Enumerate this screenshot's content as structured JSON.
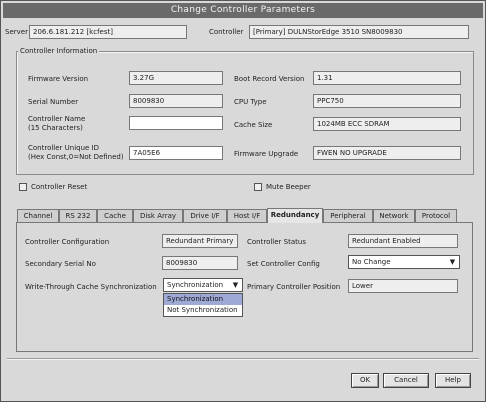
{
  "window": {
    "title": "Change Controller Parameters"
  },
  "top": {
    "server_label": "Server",
    "server_value": "206.6.181.212 [kcfest]",
    "controller_label": "Controller",
    "controller_value": "[Primary] DULNStorEdge 3510 SN8009830"
  },
  "controller_info": {
    "legend": "Controller Information",
    "firmware_label": "Firmware Version",
    "firmware_value": "3.27G",
    "bootrecord_label": "Boot Record Version",
    "bootrecord_value": "1.31",
    "serial_label": "Serial Number",
    "serial_value": "8009830",
    "cpu_label": "CPU Type",
    "cpu_value": "PPC750",
    "name_label_1": "Controller Name",
    "name_label_2": "(15 Characters)",
    "name_value": "",
    "cache_label": "Cache Size",
    "cache_value": "1024MB ECC SDRAM",
    "unique_label_1": "Controller Unique ID",
    "unique_label_2": "(Hex Const,0=Not Defined)",
    "unique_value": "7A05E6",
    "fw_upgrade_label": "Firmware Upgrade",
    "fw_upgrade_value": "FWEN NO UPGRADE"
  },
  "checks": {
    "controller_reset": "Controller Reset",
    "mute_beeper": "Mute Beeper"
  },
  "tabs": [
    "Channel",
    "RS 232",
    "Cache",
    "Disk Array",
    "Drive I/F",
    "Host I/F",
    "Redundancy",
    "Peripheral",
    "Network",
    "Protocol"
  ],
  "redundancy": {
    "config_label": "Controller Configuration",
    "config_value": "Redundant Primary",
    "status_label": "Controller Status",
    "status_value": "Redundant Enabled",
    "secondary_serial_label": "Secondary Serial No",
    "secondary_serial_value": "8009830",
    "set_config_label": "Set Controller Config",
    "set_config_value": "No Change",
    "write_through_label": "Write-Through Cache Synchronization",
    "write_through_value": "Synchronization",
    "primary_position_label": "Primary Controller Position",
    "primary_position_value": "Lower",
    "dropdown_options": [
      "Synchronization",
      "Not Synchronization"
    ]
  },
  "buttons": {
    "ok": "OK",
    "cancel": "Cancel",
    "help": "Help"
  },
  "icons": {
    "select_arrow": "▼"
  },
  "colors": {
    "title_bg": "#6a6a6a",
    "highlight": "#9ea9d6"
  }
}
